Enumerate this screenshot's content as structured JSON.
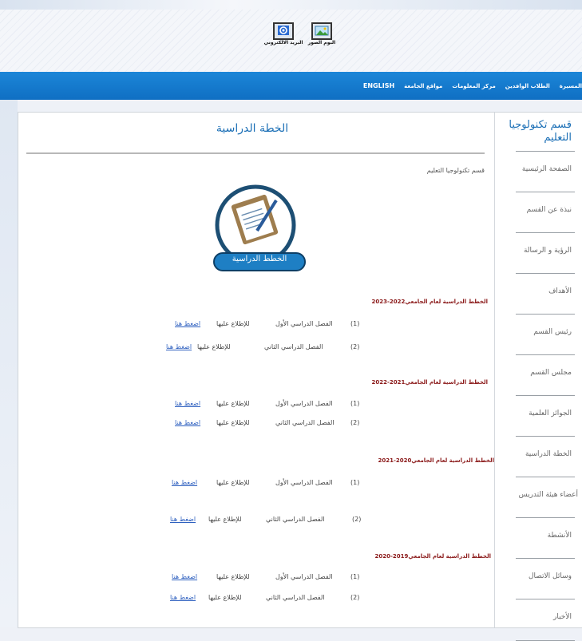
{
  "top_icons": [
    {
      "icon": "email-icon",
      "label": "البريد الالكتروني"
    },
    {
      "icon": "photo-album-icon",
      "label": "البوم الصور"
    }
  ],
  "nav": {
    "items": [
      "المسيرة",
      "الطلاب الوافدين",
      "مركز المعلومات",
      "مواقع الجامعة",
      "ENGLISH"
    ]
  },
  "sidebar": {
    "title": "قسم تكنولوجيا التعليم",
    "items": [
      "الصفحة الرئيسية",
      "نبذة عن القسم",
      "الرؤية و الرسالة",
      "الأهداف",
      "رئيس القسم",
      "مجلس القسم",
      "الجوائز العلمية",
      "الخطة الدراسية",
      "أعضاء هيئة التدريس",
      "الأنشطة",
      "وسائل الاتصال",
      "الأخبار"
    ]
  },
  "main": {
    "title": "الخطة الدراسية",
    "department_label": "قسم تكنولوجيا التعليم",
    "badge_text": "الخطط الدراسية",
    "years": [
      {
        "heading": "الخطط الدراسية لعام الجامعي2022-2023",
        "rows": [
          {
            "num": "(1)",
            "semester": "الفصل الدراسي الأول",
            "view": "للإطلاع عليها",
            "link": "اضغط هنا"
          },
          {
            "num": "(2)",
            "semester": "الفصل الدراسي الثاني",
            "view": "للإطلاع عليها",
            "link": "اضغط هنا"
          }
        ]
      },
      {
        "heading": "الخطط الدراسية لعام الجامعي2021-2022",
        "rows": [
          {
            "num": "(1)",
            "semester": "الفصل الدراسي الأول",
            "view": "للإطلاع عليها",
            "link": "اضغط هنا"
          },
          {
            "num": "(2)",
            "semester": "الفصل الدراسي الثاني",
            "view": "للإطلاع عليها",
            "link": "اضغط هنا"
          }
        ]
      },
      {
        "heading": "الخطط الدراسية لعام الجامعي2020-2021",
        "rows": [
          {
            "num": "(1)",
            "semester": "الفصل الدراسي الأول",
            "view": "للإطلاع عليها",
            "link": "اضغط هنا"
          },
          {
            "num": "(2)",
            "semester": "الفصل الدراسي الثاني",
            "view": "للإطلاع عليها",
            "link": "اضغط هنا"
          }
        ]
      },
      {
        "heading": "الخطط الدراسية لعام الجامعي2019-2020",
        "rows": [
          {
            "num": "(1)",
            "semester": "الفصل الدراسي الأول",
            "view": "للإطلاع عليها",
            "link": "اضغط هنا"
          },
          {
            "num": "(2)",
            "semester": "الفصل الدراسي الثاني",
            "view": "للإطلاع عليها",
            "link": "اضغط هنا"
          }
        ]
      }
    ]
  },
  "colors": {
    "nav_blue": "#1174c8",
    "title_blue": "#1b6fb6",
    "year_red": "#8a1818",
    "link_blue": "#2d5fbf"
  }
}
